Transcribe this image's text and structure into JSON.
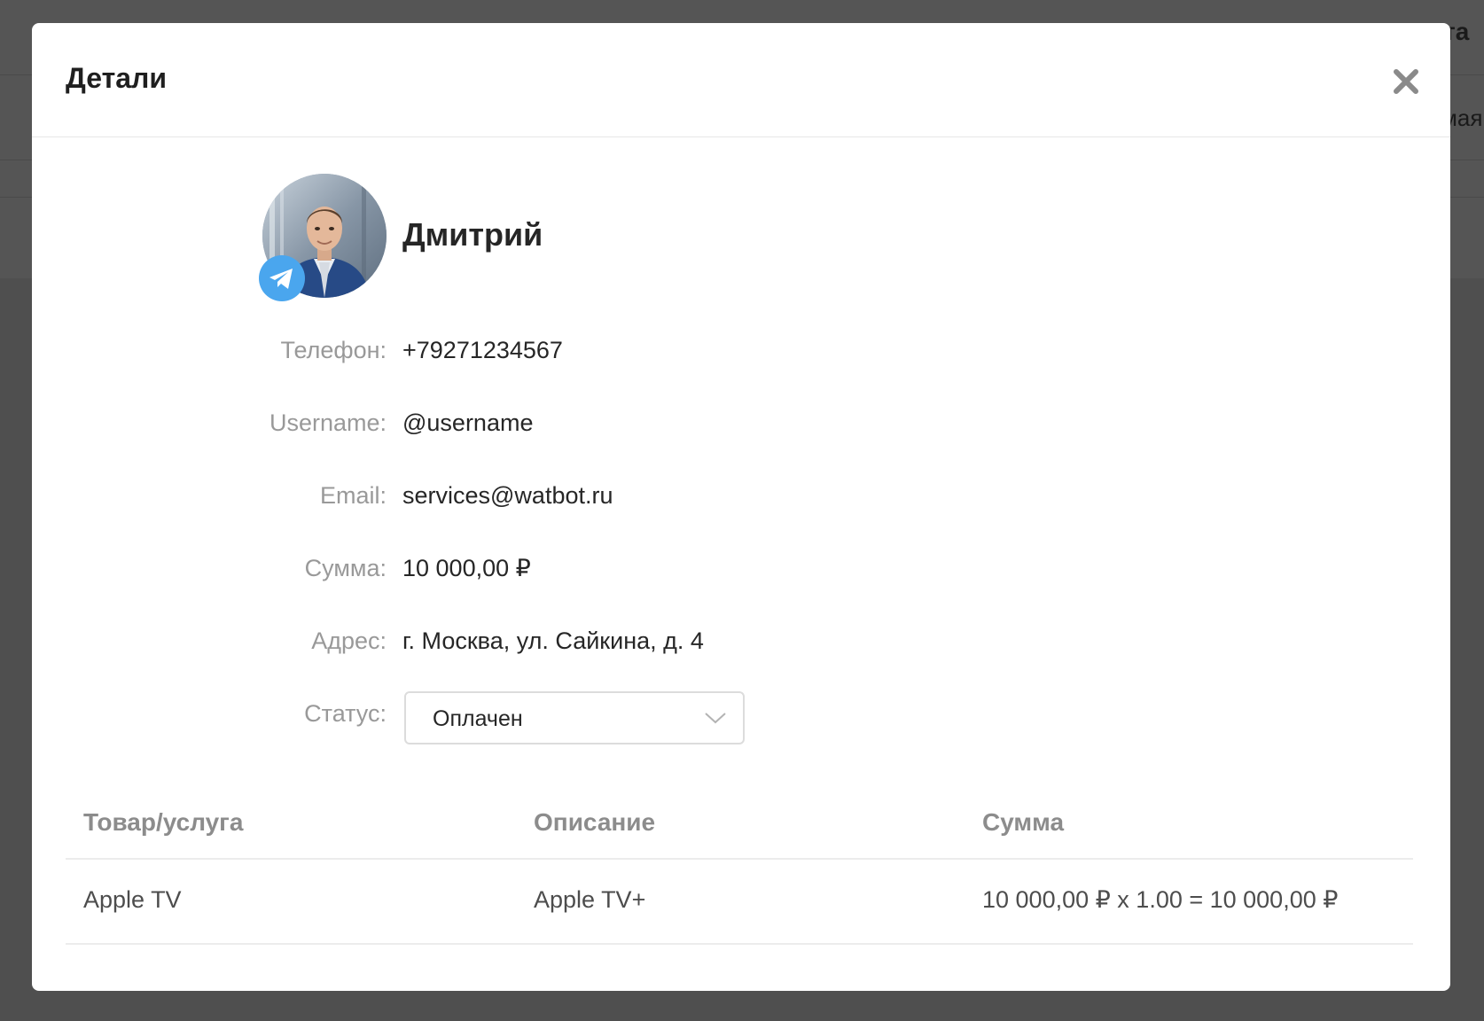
{
  "background": {
    "text_fragment_1": "та",
    "text_fragment_2": "мая"
  },
  "modal": {
    "title": "Детали",
    "close_icon": "close-icon"
  },
  "customer": {
    "name": "Дмитрий",
    "messenger_icon": "telegram-icon",
    "fields": {
      "phone": {
        "label": "Телефон:",
        "value": "+79271234567"
      },
      "username": {
        "label": "Username:",
        "value": "@username"
      },
      "email": {
        "label": "Email:",
        "value": "services@watbot.ru"
      },
      "amount": {
        "label": "Сумма:",
        "value": "10 000,00 ₽"
      },
      "address": {
        "label": "Адрес:",
        "value": "г. Москва, ул. Сайкина, д. 4"
      },
      "status": {
        "label": "Статус:",
        "value": "Оплачен"
      }
    }
  },
  "items_table": {
    "columns": [
      "Товар/услуга",
      "Описание",
      "Сумма"
    ],
    "rows": [
      [
        "Apple TV",
        "Apple TV+",
        "10 000,00 ₽ x 1.00 = 10 000,00 ₽"
      ]
    ]
  },
  "colors": {
    "accent_telegram": "#4aa6ee",
    "overlay": "#4a4a4a"
  }
}
